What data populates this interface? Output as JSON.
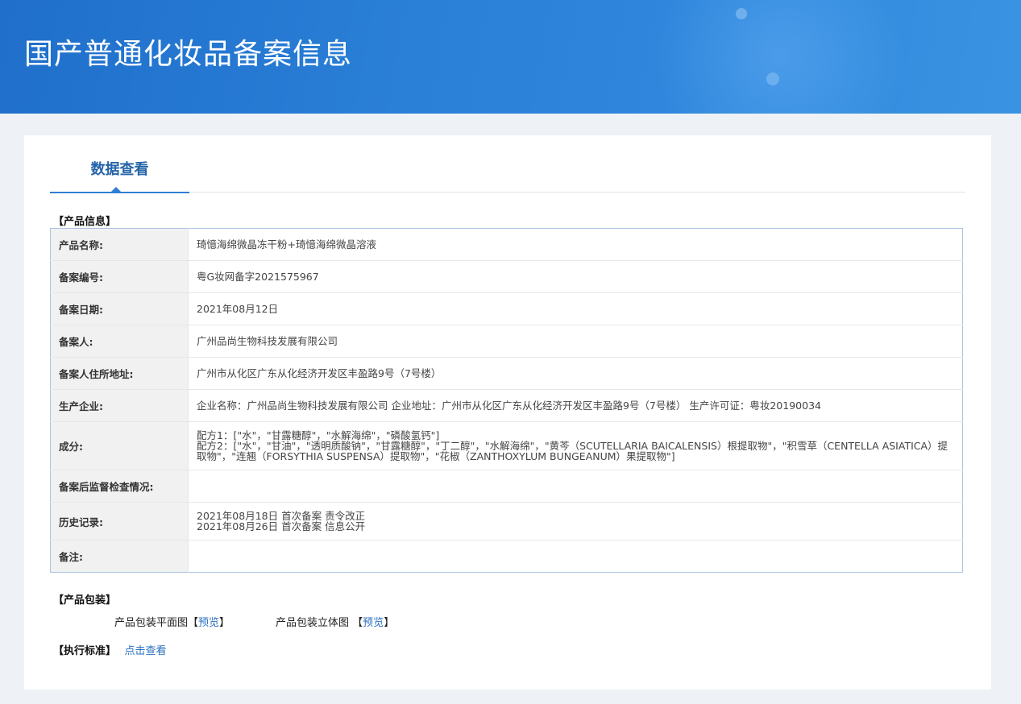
{
  "header": {
    "title": "国产普通化妆品备案信息"
  },
  "tabs": [
    {
      "label": "数据查看",
      "active": true
    }
  ],
  "sections": {
    "product_info": "【产品信息】",
    "packaging": "【产品包装】",
    "standard": "【执行标准】"
  },
  "product": {
    "rows": [
      {
        "label": "产品名称:",
        "value": "琦憶海绵微晶冻干粉+琦憶海绵微晶溶液"
      },
      {
        "label": "备案编号:",
        "value": "粤G妆网备字2021575967"
      },
      {
        "label": "备案日期:",
        "value": "2021年08月12日"
      },
      {
        "label": "备案人:",
        "value": "广州品尚生物科技发展有限公司"
      },
      {
        "label": "备案人住所地址:",
        "value": "广州市从化区广东从化经济开发区丰盈路9号（7号楼）"
      },
      {
        "label": "生产企业:",
        "value": "企业名称：广州品尚生物科技发展有限公司 企业地址：广州市从化区广东从化经济开发区丰盈路9号（7号楼） 生产许可证：粤妆20190034"
      }
    ],
    "ingredients": {
      "label": "成分:",
      "lines": [
        "配方1：[\"水\"，\"甘露糖醇\"，\"水解海绵\"，\"磷酸氢钙\"]",
        "配方2：[\"水\"，\"甘油\"，\"透明质酸钠\"，\"甘露糖醇\"，\"丁二醇\"，\"水解海绵\"，\"黄芩（SCUTELLARIA BAICALENSIS）根提取物\"，\"积雪草（CENTELLA ASIATICA）提取物\"，\"连翘（FORSYTHIA SUSPENSA）提取物\"，\"花椒（ZANTHOXYLUM BUNGEANUM）果提取物\"]"
      ]
    },
    "supervision": {
      "label": "备案后监督检查情况:",
      "value": ""
    },
    "history": {
      "label": "历史记录:",
      "lines": [
        "2021年08月18日 首次备案 责令改正",
        "2021年08月26日 首次备案 信息公开"
      ]
    },
    "remark": {
      "label": "备注:",
      "value": ""
    }
  },
  "packaging": {
    "flat_label": "产品包装平面图",
    "solid_label": "产品包装立体图",
    "bracket_open": "【",
    "bracket_close": "】",
    "preview_link": "预览"
  },
  "standard": {
    "link": "点击查看"
  }
}
